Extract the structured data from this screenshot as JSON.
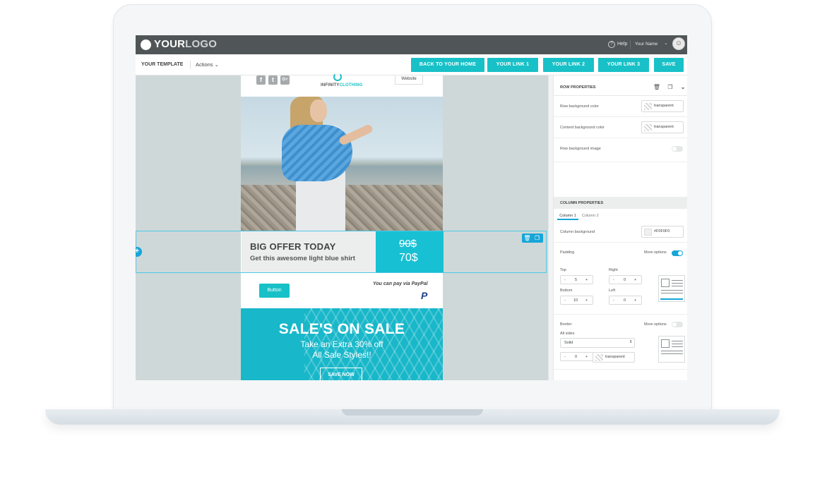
{
  "app": {
    "logo_bold": "YOUR",
    "logo_light": "LOGO",
    "help_label": "Help",
    "user_name": "Your Name"
  },
  "toolbar": {
    "template_name": "YOUR TEMPLATE",
    "actions_label": "Actions ⌄",
    "buttons": [
      {
        "label": "BACK TO YOUR HOME"
      },
      {
        "label": "YOUR LINK 1"
      },
      {
        "label": "YOUR LINK 2"
      },
      {
        "label": "YOUR LINK 3"
      },
      {
        "label": "SAVE"
      }
    ]
  },
  "email": {
    "social_icons": [
      "f",
      "t",
      "G+"
    ],
    "brand_plain": "INFINITY",
    "brand_accent": "CLOTHING",
    "website_label": "Website",
    "offer_title": "BIG OFFER TODAY",
    "offer_subtitle": "Get this awesome light blue shirt",
    "old_price": "90$",
    "new_price": "70$",
    "cta_button": "Button",
    "paypal_text": "You can pay via PayPal",
    "sale_title": "SALE'S ON SALE",
    "sale_line1": "Take an Extra 30% off",
    "sale_line2": "All Sale Styles!!",
    "sale_button": "SAVE NOW"
  },
  "panel": {
    "row_properties": "ROW PROPERTIES",
    "row_bg_color_label": "Row background color",
    "row_bg_color_value": "transparent",
    "content_bg_color_label": "Content background color",
    "content_bg_color_value": "transparent",
    "row_bg_image_label": "Row background image",
    "column_properties": "COLUMN PROPERTIES",
    "tabs": [
      "Column 1",
      "Column 2"
    ],
    "column_bg_label": "Column background",
    "column_bg_value": "#F0F0F0",
    "padding_label": "Padding",
    "more_options": "More options",
    "padding": {
      "top_label": "Top",
      "top_value": "5",
      "right_label": "Right",
      "right_value": "0",
      "bottom_label": "Bottom",
      "bottom_value": "10",
      "left_label": "Left",
      "left_value": "0"
    },
    "border_label": "Border",
    "border_more_options": "More options",
    "all_sides_label": "All sides",
    "border_style": "Solid",
    "border_width": "0",
    "border_color": "transparent"
  },
  "colors": {
    "accent": "#17c1c7",
    "topbar": "#505557",
    "canvas_bg": "#ced8d8",
    "selection": "#4fc9e8"
  }
}
